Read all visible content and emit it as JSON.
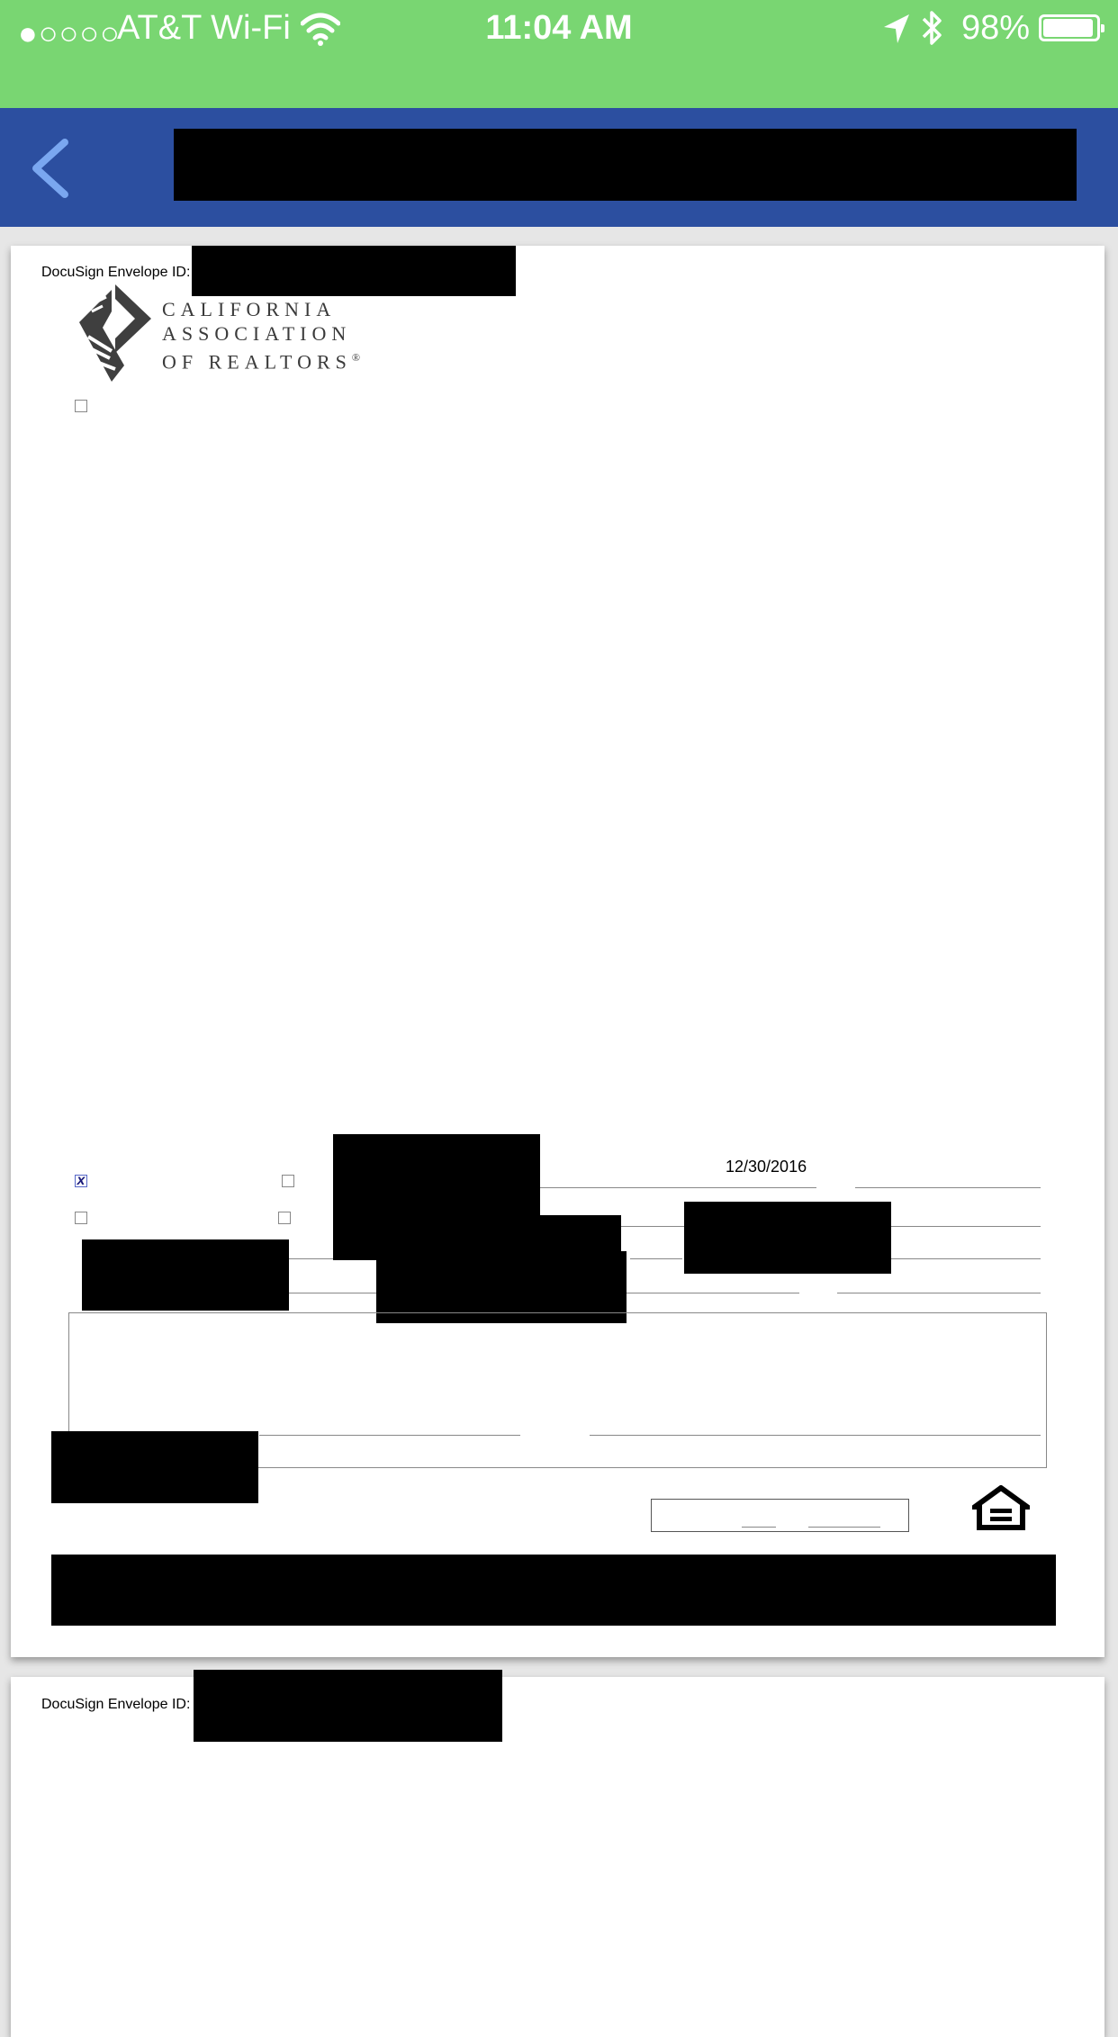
{
  "status_bar": {
    "signal": "●○○○○",
    "carrier": "AT&T Wi-Fi",
    "time": "11:04 AM",
    "battery_pct": "98%",
    "battery_level": 0.98
  },
  "nav": {
    "back_icon": "chevron-left-icon"
  },
  "page1": {
    "envelope_label": "DocuSign Envelope ID:",
    "logo": {
      "line1": "CALIFORNIA",
      "line2": "ASSOCIATION",
      "line3": "OF REALTORS",
      "mark": "®"
    },
    "checkbox_x": "x",
    "date": "12/30/2016"
  },
  "page2": {
    "envelope_label": "DocuSign Envelope ID:"
  },
  "colors": {
    "status_bar_bg": "#79d672",
    "nav_bar_bg": "#2c4fa0",
    "back_chevron": "#7aa7f0"
  }
}
